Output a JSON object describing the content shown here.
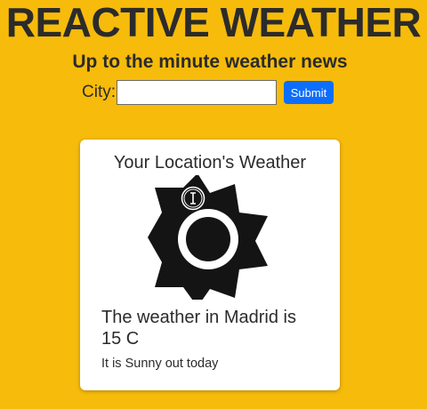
{
  "header": {
    "title": "REACTIVE WEATHER",
    "subtitle": "Up to the minute weather news"
  },
  "search": {
    "label": "City:",
    "value": "",
    "submit_label": "Submit"
  },
  "card": {
    "title": "Your Location's Weather",
    "icon": "sun-icon",
    "heading_line1": "The weather in Madrid is",
    "heading_line2": "15 C",
    "description": "It is Sunny out today"
  },
  "colors": {
    "background": "#f7bb0b",
    "text": "#2b2b2b",
    "submit_button": "#0d6efd",
    "card": "#ffffff"
  }
}
